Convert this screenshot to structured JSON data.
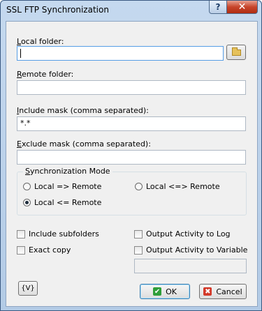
{
  "window": {
    "title": "SSL FTP Synchronization",
    "help_glyph": "?",
    "close_glyph": "✕",
    "icon": "app-icon"
  },
  "form": {
    "local_folder": {
      "label_key": "L",
      "label_rest": "ocal folder:",
      "value": ""
    },
    "remote_folder": {
      "label_key": "R",
      "label_rest": "emote folder:",
      "value": ""
    },
    "include_mask": {
      "label_key": "I",
      "label_rest": "nclude mask (comma separated):",
      "value": "*.*"
    },
    "exclude_mask": {
      "label_key": "E",
      "label_rest": "xclude mask (comma separated):",
      "value": ""
    },
    "browse_icon": "folder-icon"
  },
  "sync_mode": {
    "label_key": "S",
    "label_rest": "ynchronization Mode",
    "options": [
      {
        "label": "Local => Remote",
        "checked": false
      },
      {
        "label": "Local <=> Remote",
        "checked": false
      },
      {
        "label": "Local <= Remote",
        "checked": true
      }
    ]
  },
  "options": {
    "include_subfolders": {
      "label": "Include subfolders",
      "checked": false
    },
    "exact_copy": {
      "label": "Exact copy",
      "checked": false
    },
    "output_log": {
      "label": "Output Activity to Log",
      "checked": false
    },
    "output_variable": {
      "label": "Output Activity to Variable",
      "checked": false
    },
    "variable_value": ""
  },
  "buttons": {
    "variables": "{V}",
    "ok": "OK",
    "ok_icon": "✔",
    "cancel": "Cancel",
    "cancel_icon": "✖"
  }
}
